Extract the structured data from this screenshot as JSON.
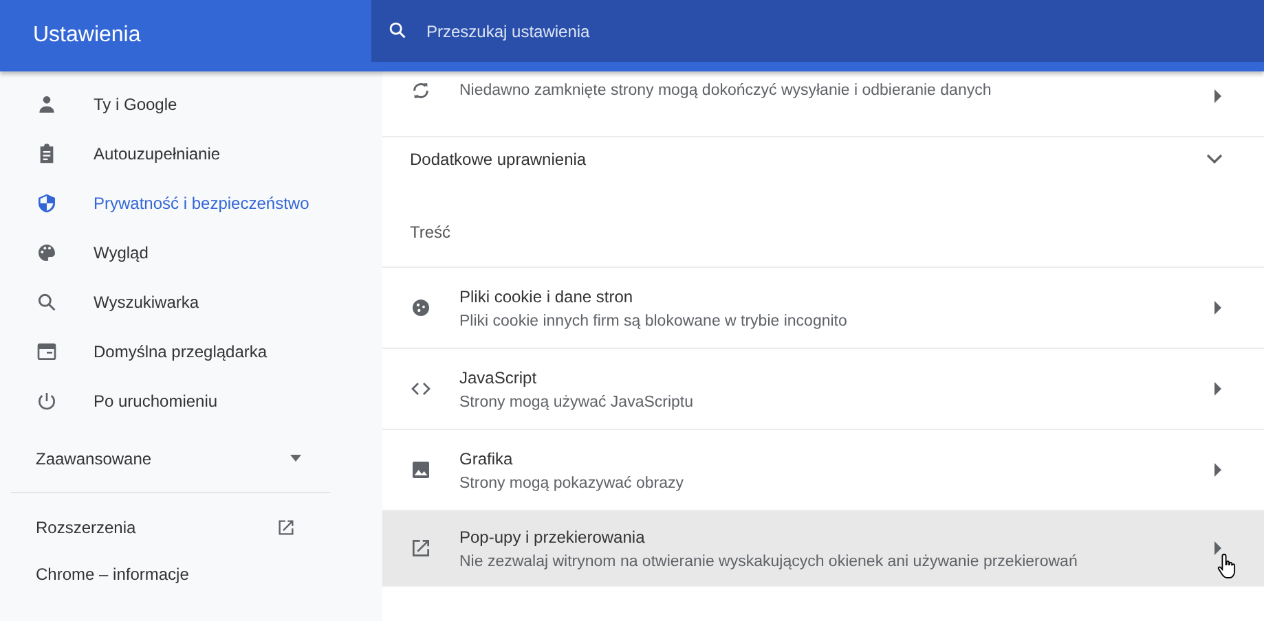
{
  "header": {
    "title": "Ustawienia",
    "search": {
      "placeholder": "Przeszukaj ustawienia"
    }
  },
  "sidebar": {
    "items": [
      {
        "label": "Ty i Google",
        "selected": false
      },
      {
        "label": "Autouzupełnianie",
        "selected": false
      },
      {
        "label": "Prywatność i bezpieczeństwo",
        "selected": true
      },
      {
        "label": "Wygląd",
        "selected": false
      },
      {
        "label": "Wyszukiwarka",
        "selected": false
      },
      {
        "label": "Domyślna przeglądarka",
        "selected": false
      },
      {
        "label": "Po uruchomieniu",
        "selected": false
      }
    ],
    "advanced": {
      "label": "Zaawansowane",
      "expanded": false
    },
    "links": [
      {
        "label": "Rozszerzenia"
      },
      {
        "label": "Chrome – informacje"
      }
    ]
  },
  "content": {
    "top_row": {
      "description": "Niedawno zamknięte strony mogą dokończyć wysyłanie i odbieranie danych"
    },
    "more_permissions": {
      "label": "Dodatkowe uprawnienia",
      "expanded": false
    },
    "section_title": "Treść",
    "rows": [
      {
        "title": "Pliki cookie i dane stron",
        "description": "Pliki cookie innych firm są blokowane w trybie incognito",
        "hovered": false
      },
      {
        "title": "JavaScript",
        "description": "Strony mogą używać JavaScriptu",
        "hovered": false
      },
      {
        "title": "Grafika",
        "description": "Strony mogą pokazywać obrazy",
        "hovered": false
      },
      {
        "title": "Pop-upy i przekierowania",
        "description": "Nie zezwalaj witrynom na otwieranie wyskakujących okienek ani używanie przekierowań",
        "hovered": true
      }
    ]
  }
}
